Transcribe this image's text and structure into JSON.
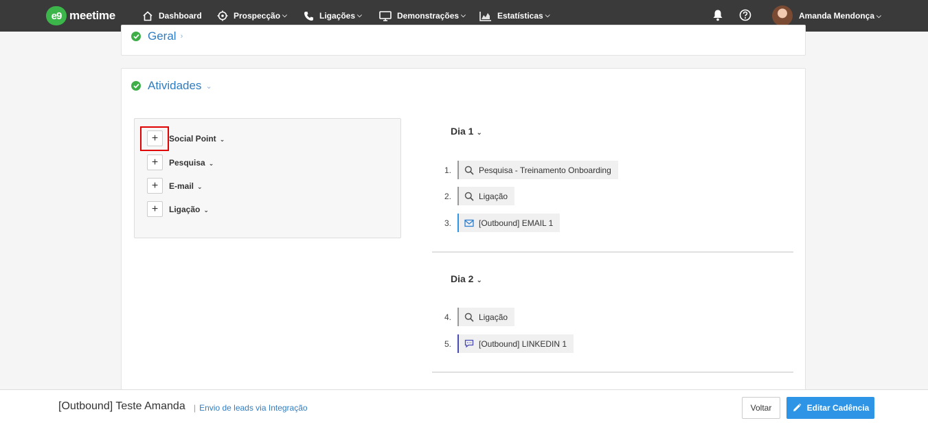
{
  "nav": {
    "logo_badge": "e9",
    "logo_text": "meetime",
    "items": [
      {
        "label": "Dashboard",
        "icon": "home-icon"
      },
      {
        "label": "Prospecção",
        "icon": "crosshair-icon"
      },
      {
        "label": "Ligações",
        "icon": "phone-icon"
      },
      {
        "label": "Demonstrações",
        "icon": "monitor-icon"
      },
      {
        "label": "Estatísticas",
        "icon": "chart-icon"
      }
    ],
    "user_name": "Amanda Mendonça"
  },
  "sections": {
    "geral": "Geral",
    "atividades": "Atividades"
  },
  "activity_types": [
    {
      "label": "Social Point"
    },
    {
      "label": "Pesquisa"
    },
    {
      "label": "E-mail"
    },
    {
      "label": "Ligação"
    }
  ],
  "days": [
    {
      "title": "Dia 1",
      "steps": [
        {
          "num": "1.",
          "label": "Pesquisa - Treinamento Onboarding",
          "icon": "search-icon"
        },
        {
          "num": "2.",
          "label": "Ligação",
          "icon": "search-icon"
        },
        {
          "num": "3.",
          "label": "[Outbound] EMAIL 1",
          "icon": "mail-icon"
        }
      ]
    },
    {
      "title": "Dia 2",
      "steps": [
        {
          "num": "4.",
          "label": "Ligação",
          "icon": "search-icon"
        },
        {
          "num": "5.",
          "label": "[Outbound] LINKEDIN 1",
          "icon": "chat-icon"
        }
      ]
    }
  ],
  "footer": {
    "title": "[Outbound] Teste Amanda",
    "separator": "|",
    "subtitle": "Envio de leads via Integração",
    "back_label": "Voltar",
    "edit_label": "Editar Cadência"
  },
  "colors": {
    "accent": "#2e95e6",
    "success": "#3fae49",
    "nav_bg": "#3a3a3a",
    "highlight": "#e00000"
  }
}
